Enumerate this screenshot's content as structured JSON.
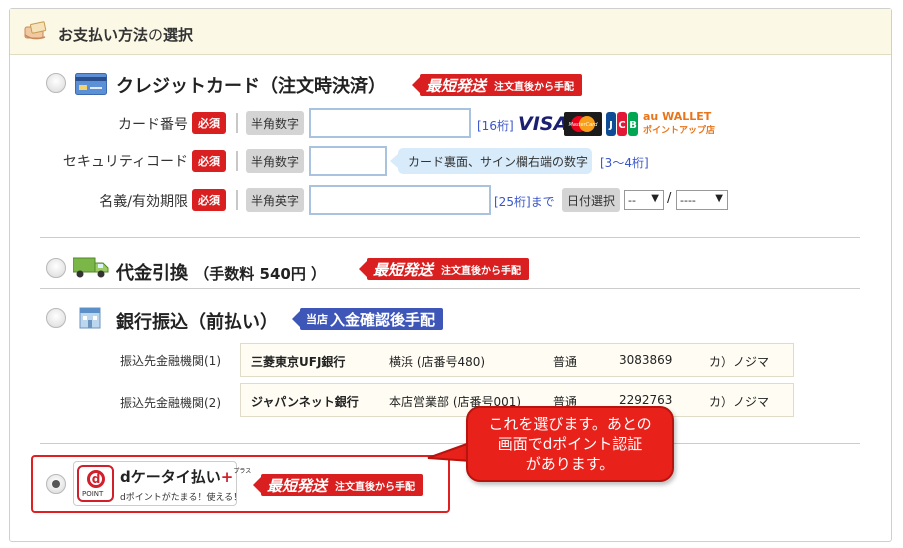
{
  "header": {
    "title_bold": "お支払い方法",
    "title_light": "の",
    "title_bold2": "選択",
    "icon": "payment-hand-icon"
  },
  "credit": {
    "title": "クレジットカード（注文時決済）",
    "badge_main": "最短発送",
    "badge_sub": "注文直後から手配",
    "card_number_label": "カード番号",
    "security_label": "セキュリティコード",
    "name_expiry_label": "名義/有効期限",
    "required": "必須",
    "hankaku_suji": "半角数字",
    "hankaku_eiji": "半角英字",
    "card_digits": "[16桁]",
    "security_hint": "カード裏面、サイン欄右端の数字",
    "security_digits": "[3～4桁]",
    "name_digits": "[25桁]まで",
    "date_select": "日付選択",
    "month_value": "--",
    "year_value": "----",
    "date_slash": "/",
    "brands": [
      "VISA",
      "MasterCard",
      "JCB"
    ],
    "au_wallet_top": "au WALLET",
    "au_wallet_bottom": "ポイントアップ店"
  },
  "cod": {
    "title": "代金引換",
    "subtitle": "（手数料 540円 ）",
    "badge_main": "最短発送",
    "badge_sub": "注文直後から手配"
  },
  "bank": {
    "title": "銀行振込（前払い）",
    "badge_small": "当店",
    "badge_main": "入金確認後手配",
    "rows": [
      {
        "label": "振込先金融機関(1)",
        "bank": "三菱東京UFJ銀行",
        "branch": "横浜 (店番号480)",
        "type": "普通",
        "number": "3083869",
        "holder": "カ）ノジマ"
      },
      {
        "label": "振込先金融機関(2)",
        "bank": "ジャパンネット銀行",
        "branch": "本店営業部 (店番号001)",
        "type": "普通",
        "number": "2292763",
        "holder": "カ）ノジマ"
      }
    ]
  },
  "dpay": {
    "point_text": "POINT",
    "point_d": "d",
    "title_d": "d",
    "title": "ケータイ払い",
    "plus": "+",
    "plus_small": "プラス",
    "sub": "dポイントがたまる！使える！",
    "badge_main": "最短発送",
    "badge_sub": "注文直後から手配"
  },
  "callout": {
    "line1": "これを選びます。あとの",
    "line2": "画面でdポイント認証",
    "line3": "があります。"
  },
  "colors": {
    "badge_red": "#d91f1f",
    "badge_blue": "#3d56b8",
    "header_bg": "#fbf8e6",
    "callout_red": "#e8211b"
  }
}
